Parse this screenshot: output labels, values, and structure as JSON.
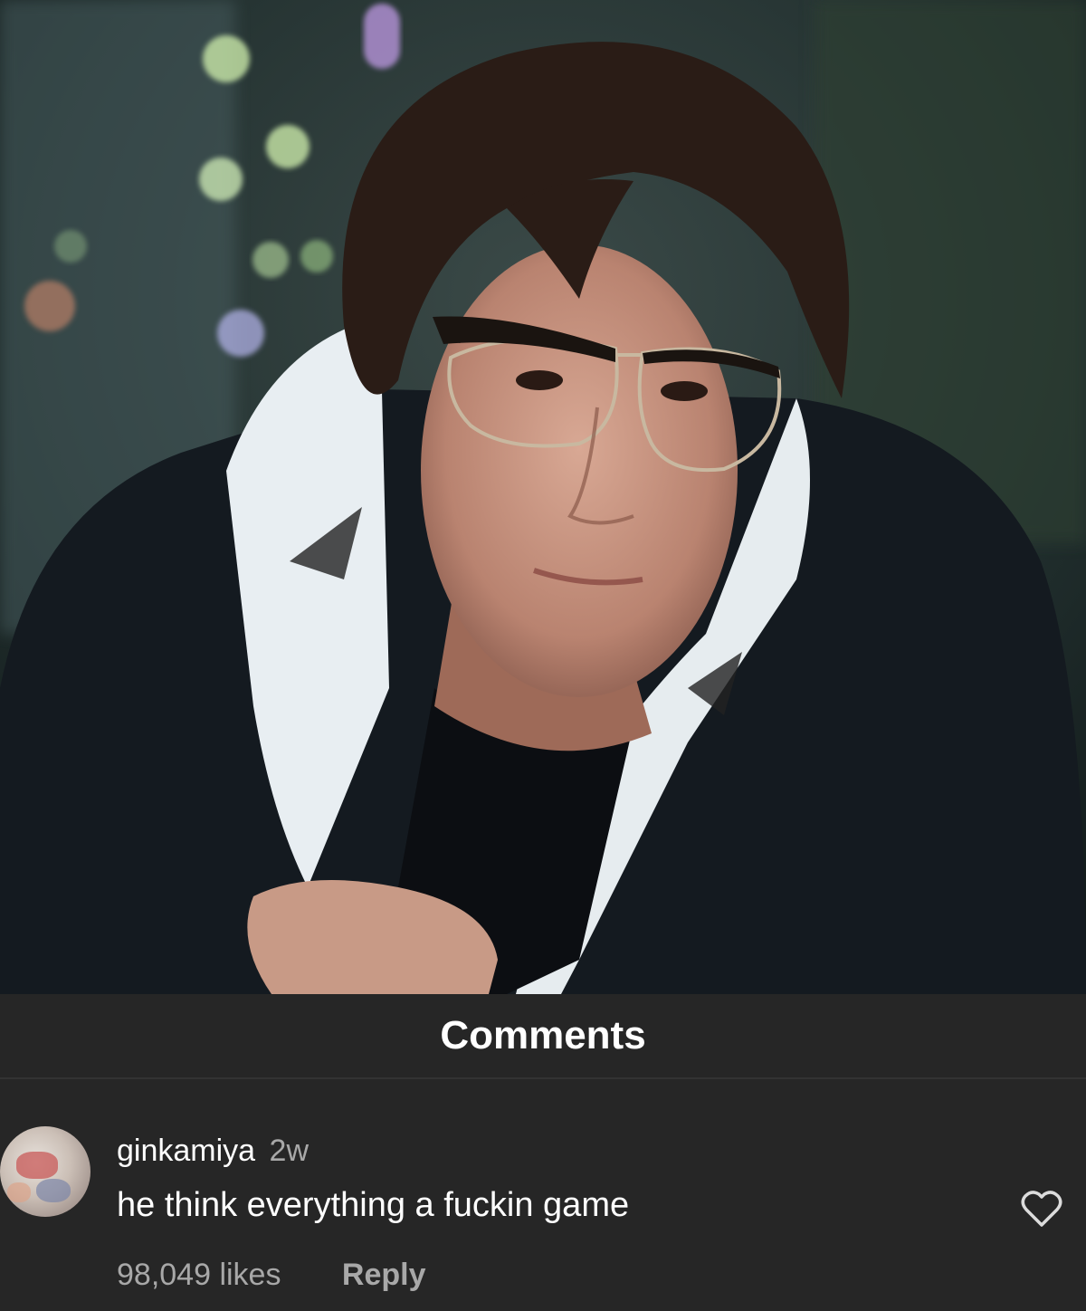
{
  "photo": {
    "description_icon": "portrait-photo"
  },
  "comments_panel": {
    "title": "Comments",
    "comment": {
      "username": "ginkamiya",
      "time": "2w",
      "text": "he think everything a fuckin game",
      "likes": "98,049 likes",
      "reply_label": "Reply",
      "like_icon": "heart-outline-icon"
    }
  },
  "colors": {
    "panel_bg": "#262626",
    "primary_text": "#ffffff",
    "secondary_text": "#a8a8a8"
  }
}
